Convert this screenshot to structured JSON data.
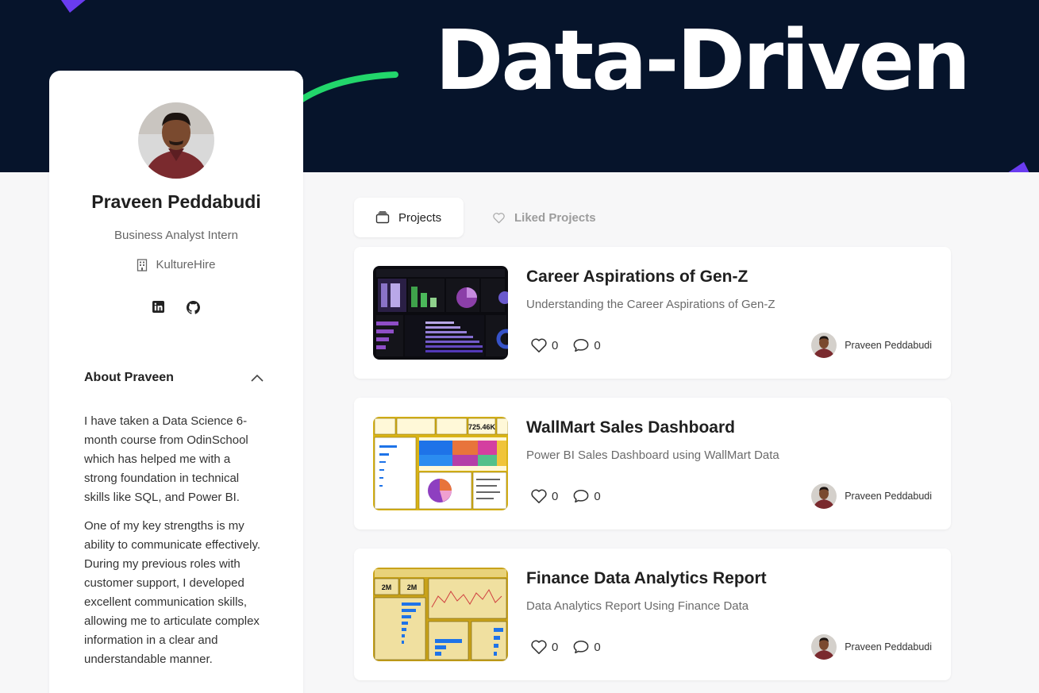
{
  "banner": {
    "title": "Data-Driven"
  },
  "profile": {
    "name": "Praveen Peddabudi",
    "role": "Business Analyst Intern",
    "company": "KultureHire",
    "social": [
      "linkedin-icon",
      "github-icon"
    ],
    "about_title": "About Praveen",
    "about_paragraphs": [
      "I have taken a Data Science 6-month course from OdinSchool which has helped me with a strong foundation in technical skills like SQL, and Power BI.",
      "One of my key strengths is my ability to communicate effectively. During my previous roles with customer support, I developed excellent communication skills, allowing me to articulate complex information in a clear and understandable manner."
    ]
  },
  "tabs": [
    {
      "label": "Projects",
      "icon": "folder-icon",
      "active": true
    },
    {
      "label": "Liked Projects",
      "icon": "heart-icon",
      "active": false
    }
  ],
  "projects": [
    {
      "title": "Career Aspirations of Gen-Z",
      "description": "Understanding the Career Aspirations of Gen-Z",
      "likes": "0",
      "comments": "0",
      "author": "Praveen Peddabudi",
      "thumb_theme": "dark-dashboard"
    },
    {
      "title": "WallMart Sales Dashboard",
      "description": "Power BI Sales Dashboard using WallMart Data",
      "likes": "0",
      "comments": "0",
      "author": "Praveen Peddabudi",
      "thumb_theme": "yellow-dashboard",
      "thumb_kpi": "725.46K"
    },
    {
      "title": "Finance Data Analytics Report",
      "description": "Data Analytics Report Using Finance Data",
      "likes": "0",
      "comments": "0",
      "author": "Praveen Peddabudi",
      "thumb_theme": "gold-dashboard",
      "thumb_kpis": [
        "2M",
        "2M"
      ]
    }
  ],
  "colors": {
    "banner_bg": "#06142b",
    "accent_purple": "#6a3cf0",
    "accent_green": "#22d66b",
    "page_bg": "#f7f7f8"
  }
}
